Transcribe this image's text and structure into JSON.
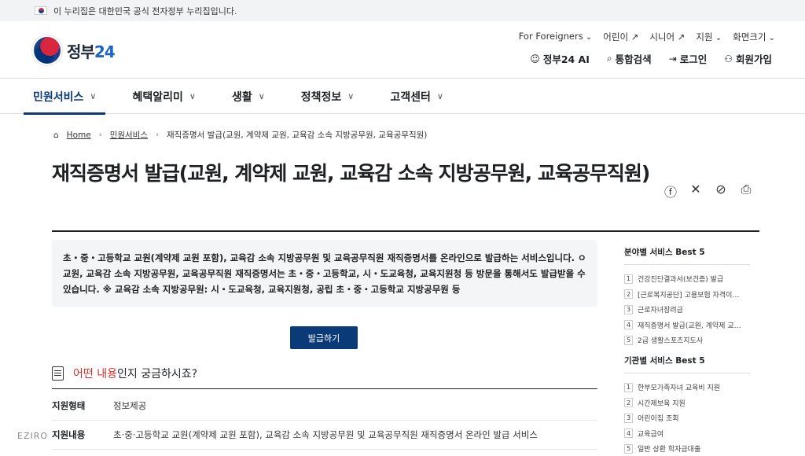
{
  "banner": {
    "text": "이 누리집은 대한민국 공식 전자정부 누리집입니다."
  },
  "logo": {
    "text": "정부",
    "num": "24"
  },
  "util_links": [
    "For Foreigners",
    "어린이",
    "시니어",
    "지원",
    "화면크기"
  ],
  "actions": [
    {
      "icon": "ai-icon",
      "label": "정부24 AI"
    },
    {
      "icon": "search-icon",
      "label": "통합검색"
    },
    {
      "icon": "login-icon",
      "label": "로그인"
    },
    {
      "icon": "join-icon",
      "label": "회원가입"
    }
  ],
  "gnb": [
    "민원서비스",
    "혜택알리미",
    "생활",
    "정책정보",
    "고객센터"
  ],
  "breadcrumb": {
    "home": "Home",
    "level1": "민원서비스",
    "current": "재직증명서 발급(교원, 계약제 교원, 교육감 소속 지방공무원, 교육공무직원)"
  },
  "title": "재직증명서 발급(교원, 계약제 교원, 교육감 소속 지방공무원, 교육공무직원)",
  "summary": "초・중・고등학교 교원(계약제 교원 포함), 교육감 소속 지방공무원 및 교육공무직원 재직증명서를 온라인으로 발급하는 서비스입니다. ㅇ 교원, 교육감 소속 지방공무원, 교육공무직원 재직증명서는 초・중・고등학교, 시・도교육청, 교육지원청 등 방문을 통해서도 발급받을 수 있습니다. ※ 교육감 소속 지방공무원: 시・도교육청, 교육지원청, 공립 초・중・고등학교 지방공무원 등",
  "apply_button": "발급하기",
  "question": {
    "red": "어떤 내용",
    "rest": "인지 궁금하시죠?"
  },
  "info": [
    {
      "key": "지원형태",
      "value": "정보제공"
    },
    {
      "key": "지원내용",
      "value": "초·중·고등학교 교원(계약제 교원 포함), 교육감 소속 지방공무원 및 교육공무직원 재직증명서 온라인 발급 서비스"
    }
  ],
  "side_field": {
    "title": "분야별 서비스 Best 5",
    "items": [
      "건강진단결과서(보건증) 발급",
      "[근로복지공단] 고용보험 자격이…",
      "근로자녀장려금",
      "재직증명서 발급(교원, 계약제 교…",
      "2급 생활스포츠지도사"
    ]
  },
  "side_org": {
    "title": "기관별 서비스 Best 5",
    "items": [
      "한부모가족자녀 교육비 지원",
      "시간제보육 지원",
      "어린이집 조회",
      "교육급여",
      "일반 상환 학자금대출"
    ]
  },
  "watermark": "EZIRO"
}
